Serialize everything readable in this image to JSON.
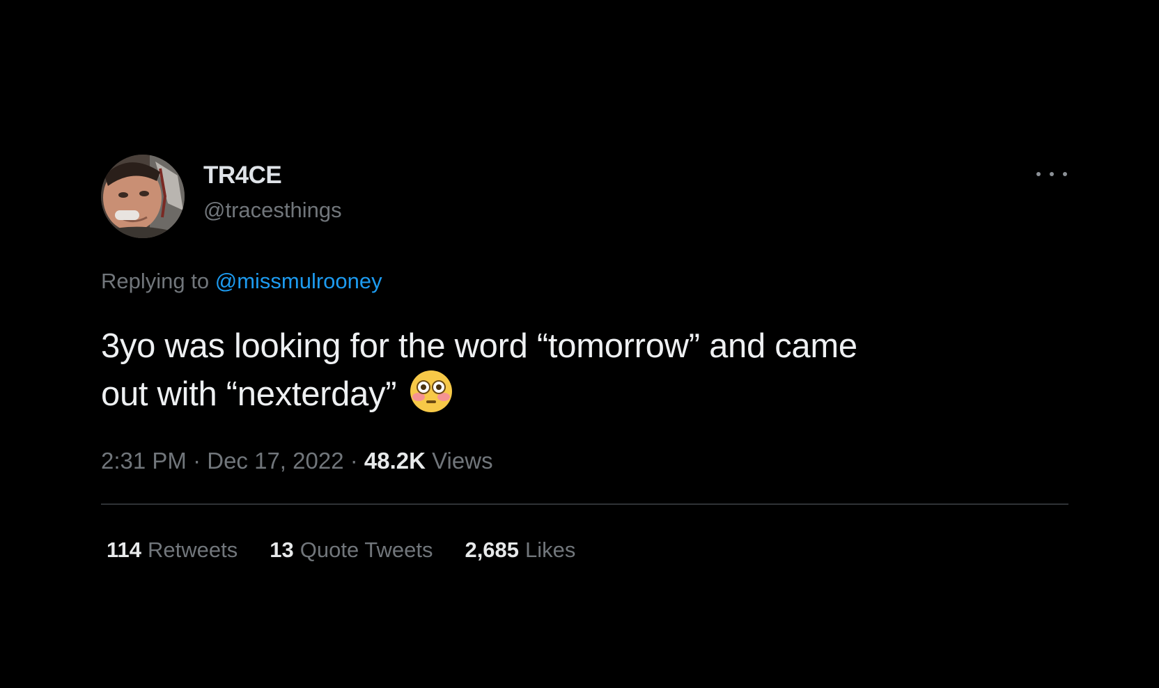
{
  "tweet": {
    "author": {
      "display_name": "TR4CE",
      "handle": "@tracesthings"
    },
    "more_icon": "more-horizontal-icon",
    "replying_to": {
      "prefix": "Replying to",
      "mention": "@missmulrooney"
    },
    "text_lines": [
      "3yo was looking for the word “tomorrow” and came",
      "out with “nexterday”"
    ],
    "emoji": "flushed-face-emoji",
    "meta": {
      "time": "2:31 PM",
      "separator": "·",
      "date": "Dec 17, 2022",
      "views_count": "48.2K",
      "views_label": "Views"
    },
    "stats": {
      "retweets": {
        "count": "114",
        "label": "Retweets"
      },
      "quote_tweets": {
        "count": "13",
        "label": "Quote Tweets"
      },
      "likes": {
        "count": "2,685",
        "label": "Likes"
      }
    }
  },
  "colors": {
    "background": "#000000",
    "primary_text": "#e7e9ea",
    "secondary_text": "#71767b",
    "link": "#1d9bf0",
    "divider": "#2f3336"
  }
}
